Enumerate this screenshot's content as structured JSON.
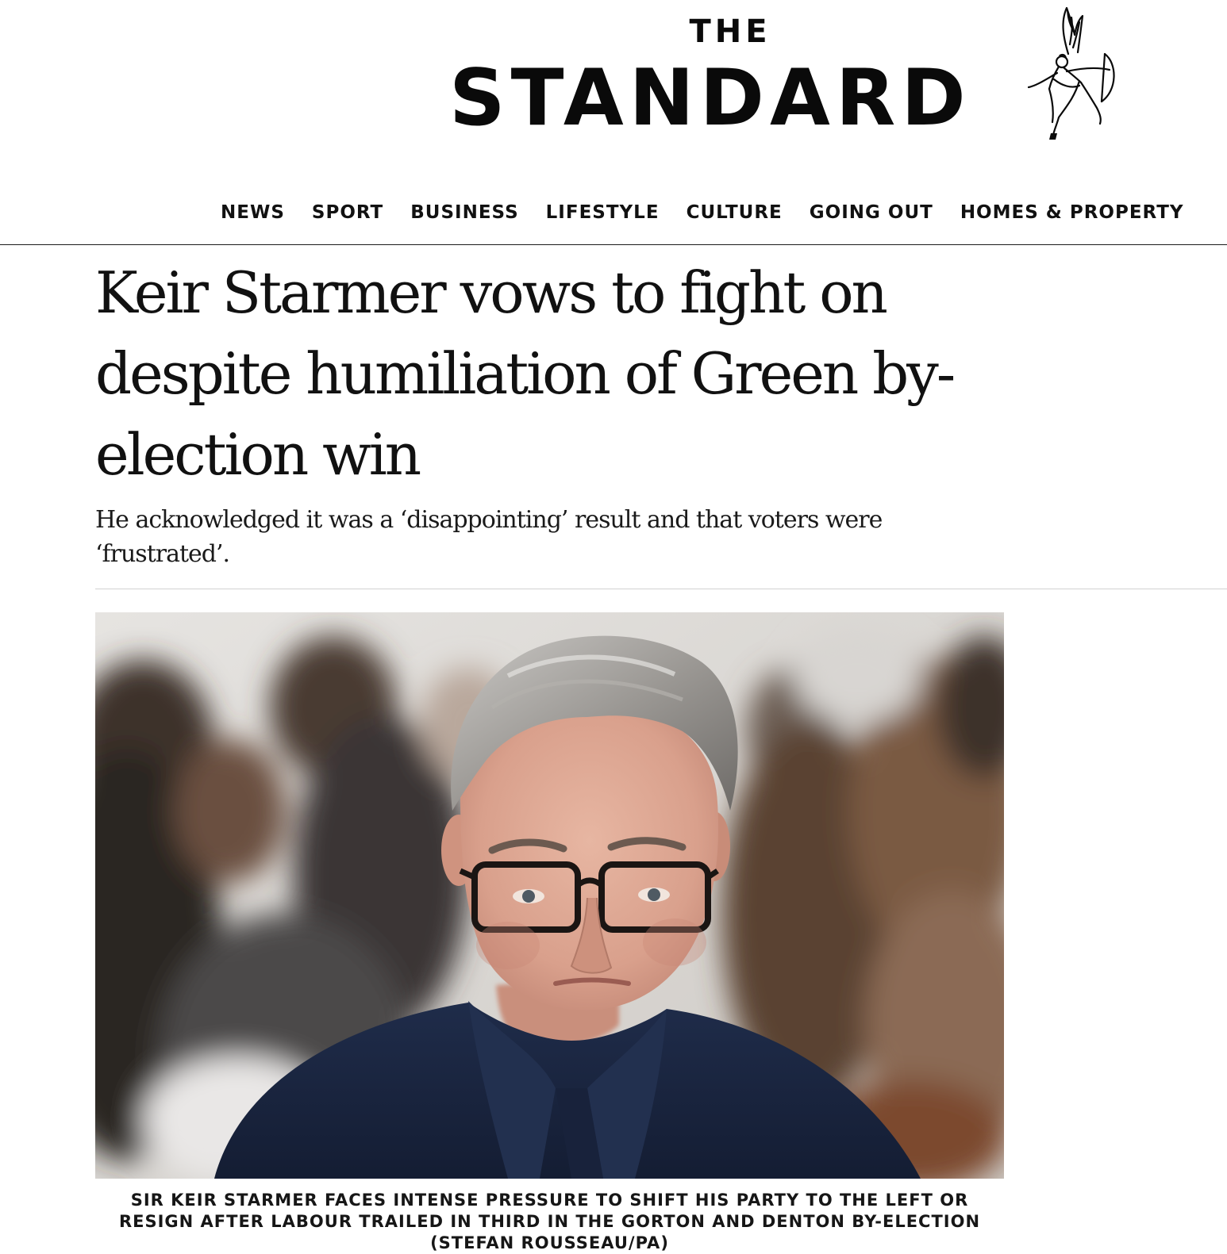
{
  "masthead": {
    "logo_top": "THE",
    "logo_main": "STANDARD",
    "logo_emblem": "eros-statue-icon"
  },
  "nav": {
    "items": [
      {
        "label": "NEWS"
      },
      {
        "label": "SPORT"
      },
      {
        "label": "BUSINESS"
      },
      {
        "label": "LIFESTYLE"
      },
      {
        "label": "CULTURE"
      },
      {
        "label": "GOING OUT"
      },
      {
        "label": "HOMES & PROPERTY"
      }
    ]
  },
  "article": {
    "headline": "Keir Starmer vows to fight on despite humiliation of Green by-election win",
    "standfirst": "He acknowledged it was a ‘disappointing’ result and that voters were ‘frustrated’.",
    "image_caption": "SIR KEIR STARMER FACES INTENSE PRESSURE TO SHIFT HIS PARTY TO THE LEFT OR RESIGN AFTER LABOUR TRAILED IN THIRD IN THE GORTON AND DENTON BY-ELECTION (STEFAN ROUSSEAU/PA)"
  },
  "colors": {
    "text": "#111111",
    "rule": "#1a1a1a",
    "light_rule": "#d2d2d2",
    "background": "#ffffff"
  }
}
